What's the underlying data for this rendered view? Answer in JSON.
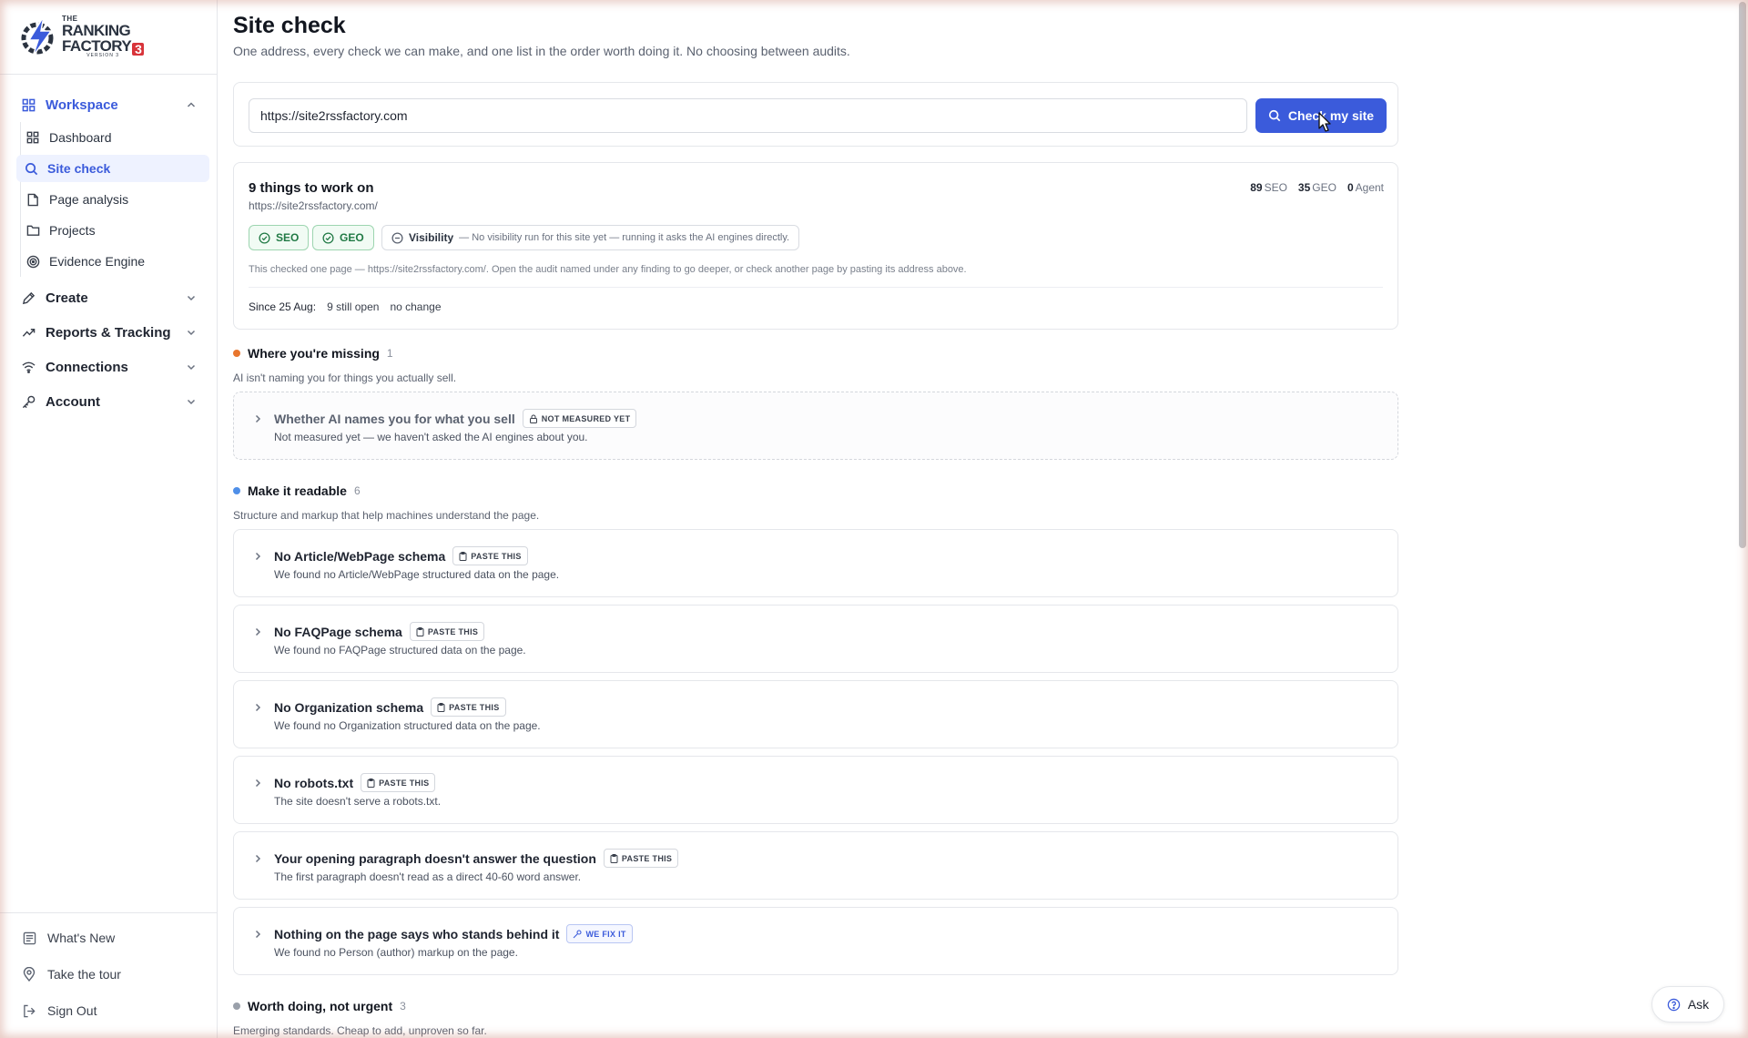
{
  "brand": {
    "logo_the": "THE",
    "logo_line1": "RANKING",
    "logo_line2": "FACTORY",
    "logo_number": "3",
    "logo_version": "VERSION 3"
  },
  "sidebar": {
    "workspace": {
      "label": "Workspace",
      "items": [
        {
          "label": "Dashboard",
          "icon": "grid-icon"
        },
        {
          "label": "Site check",
          "icon": "search-icon"
        },
        {
          "label": "Page analysis",
          "icon": "document-icon"
        },
        {
          "label": "Projects",
          "icon": "folder-icon"
        },
        {
          "label": "Evidence Engine",
          "icon": "target-icon"
        }
      ]
    },
    "groups": [
      {
        "label": "Create",
        "icon": "pen-icon"
      },
      {
        "label": "Reports & Tracking",
        "icon": "chart-icon"
      },
      {
        "label": "Connections",
        "icon": "wifi-icon"
      },
      {
        "label": "Account",
        "icon": "key-icon"
      }
    ],
    "footer": [
      {
        "label": "What's New",
        "icon": "news-icon"
      },
      {
        "label": "Take the tour",
        "icon": "map-pin-icon"
      },
      {
        "label": "Sign Out",
        "icon": "logout-icon"
      }
    ]
  },
  "page": {
    "title": "Site check",
    "subtitle": "One address, every check we can make, and one list in the order worth doing it. No choosing between audits."
  },
  "search": {
    "value": "https://site2rssfactory.com",
    "button_label": "Check my site"
  },
  "summary": {
    "title": "9 things to work on",
    "url": "https://site2rssfactory.com/",
    "scores": [
      {
        "value": "89",
        "label": "SEO"
      },
      {
        "value": "35",
        "label": "GEO"
      },
      {
        "value": "0",
        "label": "Agent"
      }
    ],
    "pills": {
      "seo": "SEO",
      "geo": "GEO",
      "visibility": "Visibility",
      "visibility_note": "— No visibility run for this site yet — running it asks the AI engines directly."
    },
    "note": "This checked one page — https://site2rssfactory.com/. Open the audit named under any finding to go deeper, or check another page by pasting its address above.",
    "since_label": "Since 25 Aug:",
    "since_open": "9 still open",
    "since_change": "no change"
  },
  "sections": {
    "missing": {
      "title": "Where you're missing",
      "count": "1",
      "color": "#e8762d",
      "desc": "AI isn't naming you for things you actually sell.",
      "findings": [
        {
          "title": "Whether AI names you for what you sell",
          "tag": "NOT MEASURED YET",
          "desc": "Not measured yet — we haven't asked the AI engines about you."
        }
      ]
    },
    "readable": {
      "title": "Make it readable",
      "count": "6",
      "color": "#4f8fe8",
      "desc": "Structure and markup that help machines understand the page.",
      "findings": [
        {
          "title": "No Article/WebPage schema",
          "tag": "PASTE THIS",
          "desc": "We found no Article/WebPage structured data on the page."
        },
        {
          "title": "No FAQPage schema",
          "tag": "PASTE THIS",
          "desc": "We found no FAQPage structured data on the page."
        },
        {
          "title": "No Organization schema",
          "tag": "PASTE THIS",
          "desc": "We found no Organization structured data on the page."
        },
        {
          "title": "No robots.txt",
          "tag": "PASTE THIS",
          "desc": "The site doesn't serve a robots.txt."
        },
        {
          "title": "Your opening paragraph doesn't answer the question",
          "tag": "PASTE THIS",
          "desc": "The first paragraph doesn't read as a direct 40-60 word answer."
        },
        {
          "title": "Nothing on the page says who stands behind it",
          "tag": "WE FIX IT",
          "desc": "We found no Person (author) markup on the page."
        }
      ]
    },
    "worth": {
      "title": "Worth doing, not urgent",
      "count": "3",
      "color": "#9aa0aa",
      "desc": "Emerging standards. Cheap to add, unproven so far."
    }
  },
  "ask": {
    "label": "Ask"
  },
  "colors": {
    "accent": "#3b5bdb",
    "success": "#217a45"
  }
}
